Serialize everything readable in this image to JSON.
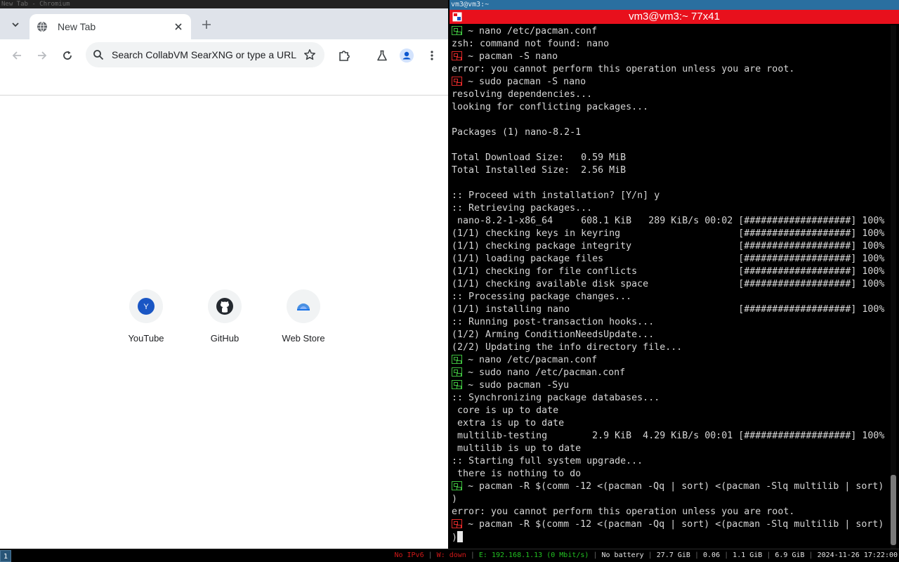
{
  "browser": {
    "window_title": "New Tab - Chromium",
    "tab": {
      "title": "New Tab"
    },
    "omnibox": {
      "placeholder": "Search CollabVM SearXNG or type a URL"
    },
    "shortcuts": [
      {
        "label": "YouTube",
        "initial": "Y",
        "icon": "youtube-letter-icon"
      },
      {
        "label": "GitHub",
        "icon": "github-icon"
      },
      {
        "label": "Web Store",
        "icon": "web-store-icon"
      }
    ]
  },
  "terminal": {
    "wm_title": "vm3@vm3:~",
    "header_title": "vm3@vm3:~ 77x41",
    "lines": [
      {
        "prompt": "ok",
        "text": "~ nano /etc/pacman.conf"
      },
      {
        "text": "zsh: command not found: nano"
      },
      {
        "prompt": "err",
        "text": "~ pacman -S nano"
      },
      {
        "text": "error: you cannot perform this operation unless you are root."
      },
      {
        "prompt": "err",
        "text": "~ sudo pacman -S nano"
      },
      {
        "text": "resolving dependencies..."
      },
      {
        "text": "looking for conflicting packages..."
      },
      {
        "text": ""
      },
      {
        "text": "Packages (1) nano-8.2-1"
      },
      {
        "text": ""
      },
      {
        "text": "Total Download Size:   0.59 MiB"
      },
      {
        "text": "Total Installed Size:  2.56 MiB"
      },
      {
        "text": ""
      },
      {
        "text": ":: Proceed with installation? [Y/n] y"
      },
      {
        "text": ":: Retrieving packages..."
      },
      {
        "text": " nano-8.2-1-x86_64     608.1 KiB   289 KiB/s 00:02 [###################] 100%"
      },
      {
        "text": "(1/1) checking keys in keyring                     [###################] 100%"
      },
      {
        "text": "(1/1) checking package integrity                   [###################] 100%"
      },
      {
        "text": "(1/1) loading package files                        [###################] 100%"
      },
      {
        "text": "(1/1) checking for file conflicts                  [###################] 100%"
      },
      {
        "text": "(1/1) checking available disk space                [###################] 100%"
      },
      {
        "text": ":: Processing package changes..."
      },
      {
        "text": "(1/1) installing nano                              [###################] 100%"
      },
      {
        "text": ":: Running post-transaction hooks..."
      },
      {
        "text": "(1/2) Arming ConditionNeedsUpdate..."
      },
      {
        "text": "(2/2) Updating the info directory file..."
      },
      {
        "prompt": "ok",
        "text": "~ nano /etc/pacman.conf"
      },
      {
        "prompt": "ok",
        "text": "~ sudo nano /etc/pacman.conf"
      },
      {
        "prompt": "ok",
        "text": "~ sudo pacman -Syu"
      },
      {
        "text": ":: Synchronizing package databases..."
      },
      {
        "text": " core is up to date"
      },
      {
        "text": " extra is up to date"
      },
      {
        "text": " multilib-testing        2.9 KiB  4.29 KiB/s 00:01 [###################] 100%"
      },
      {
        "text": " multilib is up to date"
      },
      {
        "text": ":: Starting full system upgrade..."
      },
      {
        "text": " there is nothing to do"
      },
      {
        "prompt": "ok",
        "text": "~ pacman -R $(comm -12 <(pacman -Qq | sort) <(pacman -Slq multilib | sort)"
      },
      {
        "text": ")"
      },
      {
        "text": "error: you cannot perform this operation unless you are root."
      },
      {
        "prompt": "err",
        "text": "~ pacman -R $(comm -12 <(pacman -Qq | sort) <(pacman -Slq multilib | sort)"
      },
      {
        "text": ")",
        "cursor": true
      }
    ]
  },
  "statusbar": {
    "workspace": "1",
    "items": [
      {
        "text": "No IPv6",
        "color": "#d01818"
      },
      {
        "text": "W: down",
        "color": "#d01818"
      },
      {
        "text": "E: 192.168.1.13 (0 Mbit/s)",
        "color": "#22c022"
      },
      {
        "text": "No battery",
        "color": "#e6e6e6"
      },
      {
        "text": "27.7 GiB",
        "color": "#e6e6e6"
      },
      {
        "text": "0.06",
        "color": "#e6e6e6"
      },
      {
        "text": "1.1 GiB",
        "color": "#e6e6e6"
      },
      {
        "text": "6.9 GiB",
        "color": "#e6e6e6"
      },
      {
        "text": "2024-11-26 17:22:00",
        "color": "#e6e6e6"
      }
    ]
  }
}
